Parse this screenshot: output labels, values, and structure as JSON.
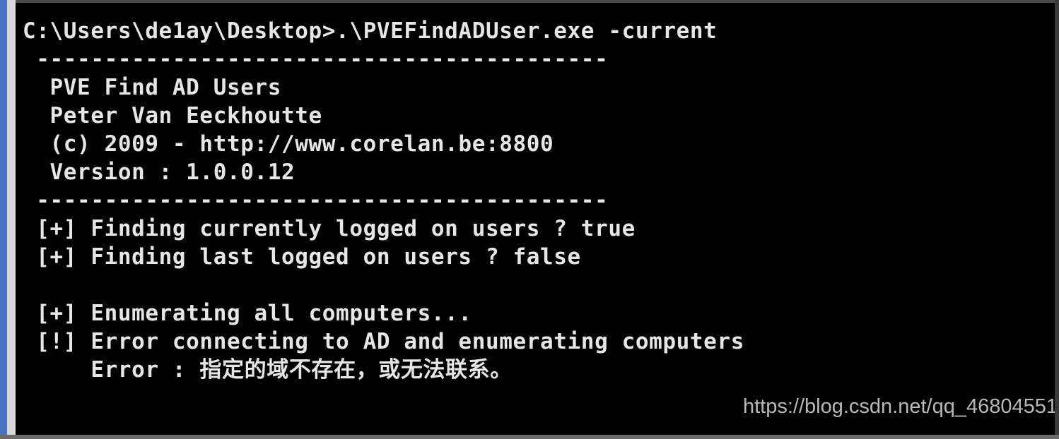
{
  "console": {
    "lines": [
      "C:\\Users\\de1ay\\Desktop>.\\PVEFindADUser.exe -current",
      " ------------------------------------------",
      "  PVE Find AD Users",
      "  Peter Van Eeckhoutte",
      "  (c) 2009 - http://www.corelan.be:8800",
      "  Version : 1.0.0.12",
      " ------------------------------------------",
      " [+] Finding currently logged on users ? true",
      " [+] Finding last logged on users ? false",
      "",
      " [+] Enumerating all computers...",
      " [!] Error connecting to AD and enumerating computers",
      "     Error : 指定的域不存在，或无法联系。"
    ]
  },
  "watermark": "https://blog.csdn.net/qq_46804551"
}
